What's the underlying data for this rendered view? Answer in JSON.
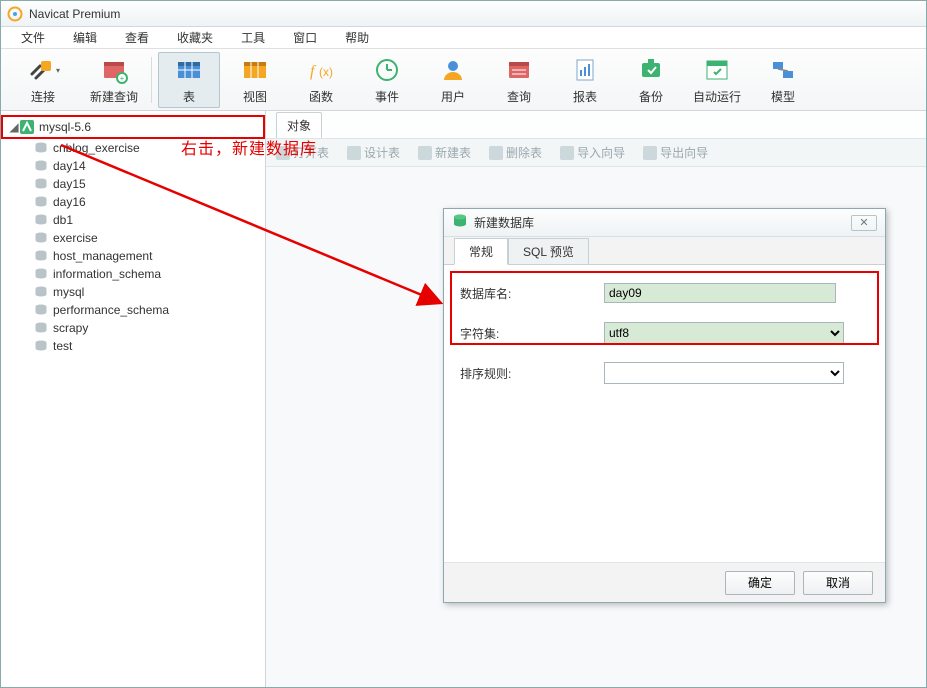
{
  "title": "Navicat Premium",
  "menu": [
    "文件",
    "编辑",
    "查看",
    "收藏夹",
    "工具",
    "窗口",
    "帮助"
  ],
  "toolbar": [
    {
      "label": "连接",
      "hasArrow": true,
      "icon": "plug"
    },
    {
      "label": "新建查询",
      "icon": "newquery"
    },
    {
      "label": "表",
      "icon": "table",
      "active": true
    },
    {
      "label": "视图",
      "icon": "view"
    },
    {
      "label": "函数",
      "icon": "fx"
    },
    {
      "label": "事件",
      "icon": "clock"
    },
    {
      "label": "用户",
      "icon": "user"
    },
    {
      "label": "查询",
      "icon": "query"
    },
    {
      "label": "报表",
      "icon": "report"
    },
    {
      "label": "备份",
      "icon": "backup"
    },
    {
      "label": "自动运行",
      "icon": "auto"
    },
    {
      "label": "模型",
      "icon": "model"
    }
  ],
  "connection": "mysql-5.6",
  "databases": [
    "cnblog_exercise",
    "day14",
    "day15",
    "day16",
    "db1",
    "exercise",
    "host_management",
    "information_schema",
    "mysql",
    "performance_schema",
    "scrapy",
    "test"
  ],
  "content_tab": "对象",
  "ops": [
    "打开表",
    "设计表",
    "新建表",
    "删除表",
    "导入向导",
    "导出向导"
  ],
  "annotation": "右击，新建数据库",
  "dialog": {
    "title": "新建数据库",
    "tabs": [
      "常规",
      "SQL 预览"
    ],
    "fields": {
      "name_label": "数据库名:",
      "name_value": "day09",
      "charset_label": "字符集:",
      "charset_value": "utf8",
      "collation_label": "排序规则:",
      "collation_value": ""
    },
    "buttons": {
      "ok": "确定",
      "cancel": "取消"
    }
  }
}
